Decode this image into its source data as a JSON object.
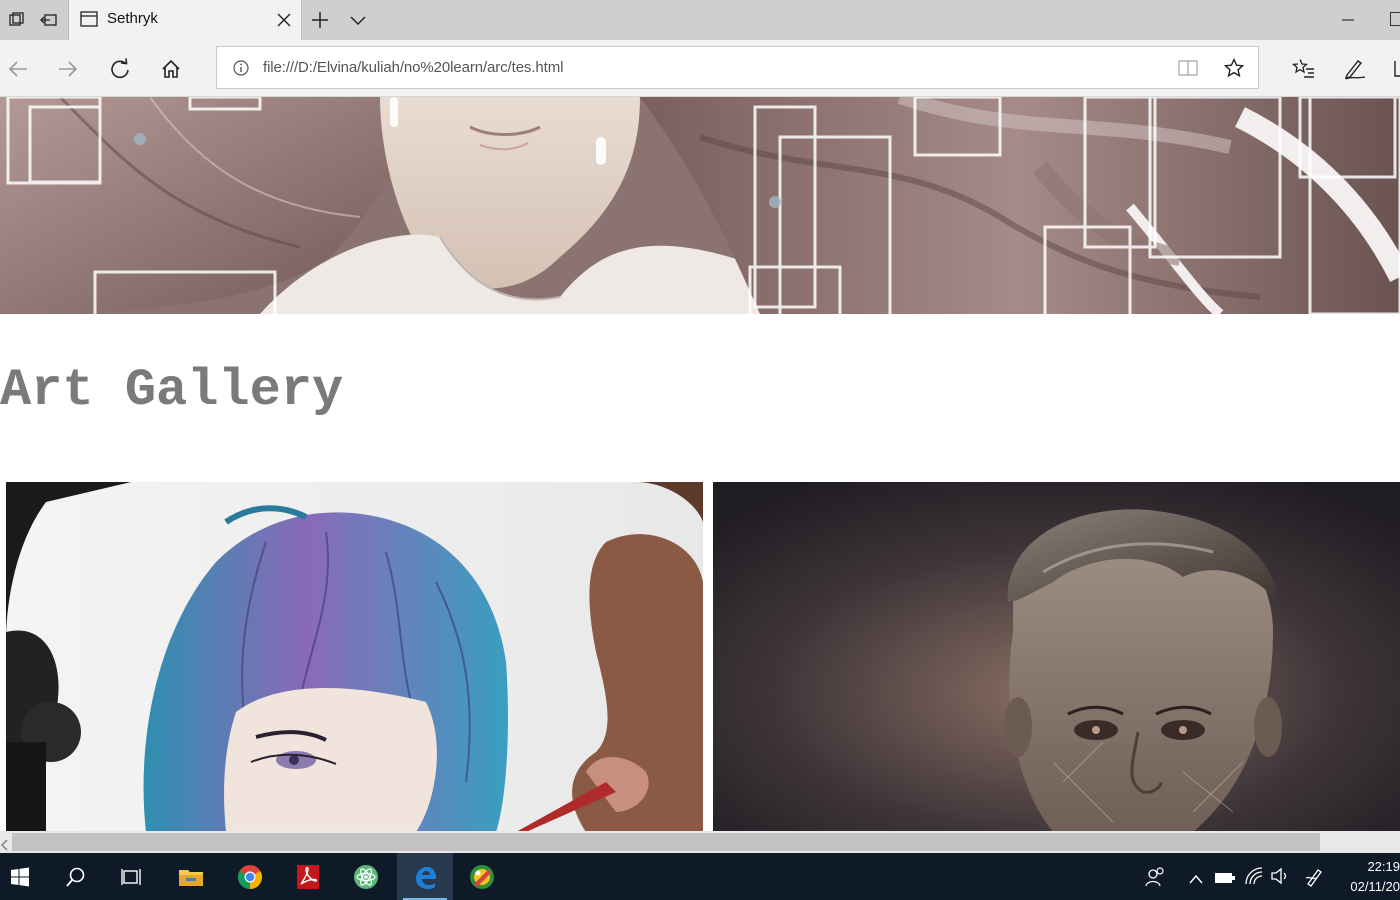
{
  "browser": {
    "tab": {
      "title": "Sethryk"
    },
    "address": {
      "url": "file:///D:/Elvina/kuliah/no%20learn/arc/tes.html"
    },
    "icons": {
      "tab_actions": [
        "set-aside-tabs-icon",
        "restore-tabs-icon"
      ],
      "tab": "tab-page-icon",
      "close": "close-icon",
      "new_tab": "plus-icon",
      "tab_list": "chevron-down-icon",
      "back": "back-arrow-icon",
      "forward": "forward-arrow-icon",
      "refresh": "refresh-icon",
      "home": "home-icon",
      "info": "info-icon",
      "reading_view": "reading-view-icon",
      "favorite": "star-icon",
      "hub": "favorites-hub-icon",
      "notes": "pen-icon"
    }
  },
  "page": {
    "heading": "Art Gallery",
    "heading_color": "#7a7a7a",
    "images": [
      {
        "subject": "banner-illustration-long-hair-girl"
      },
      {
        "subject": "blue-purple-haired-boy-drawing"
      },
      {
        "subject": "dark-portrait-man"
      }
    ]
  },
  "taskbar": {
    "apps": [
      "windows-start-icon",
      "search-icon",
      "task-view-icon",
      "file-explorer-icon",
      "chrome-icon",
      "acrobat-icon",
      "atom-icon",
      "edge-icon",
      "paint-app-icon"
    ],
    "active_app": "edge-icon",
    "tray": [
      "people-icon",
      "show-hidden-icon",
      "battery-icon",
      "wifi-icon",
      "volume-icon",
      "pen-workspace-icon"
    ],
    "clock": {
      "time": "22:19",
      "date": "02/11/20"
    }
  },
  "colors": {
    "tabbar": "#cfcfcf",
    "navbar": "#f2f2f2",
    "taskbar": "#0f1a28",
    "edge_blue": "#1e7fd8"
  }
}
